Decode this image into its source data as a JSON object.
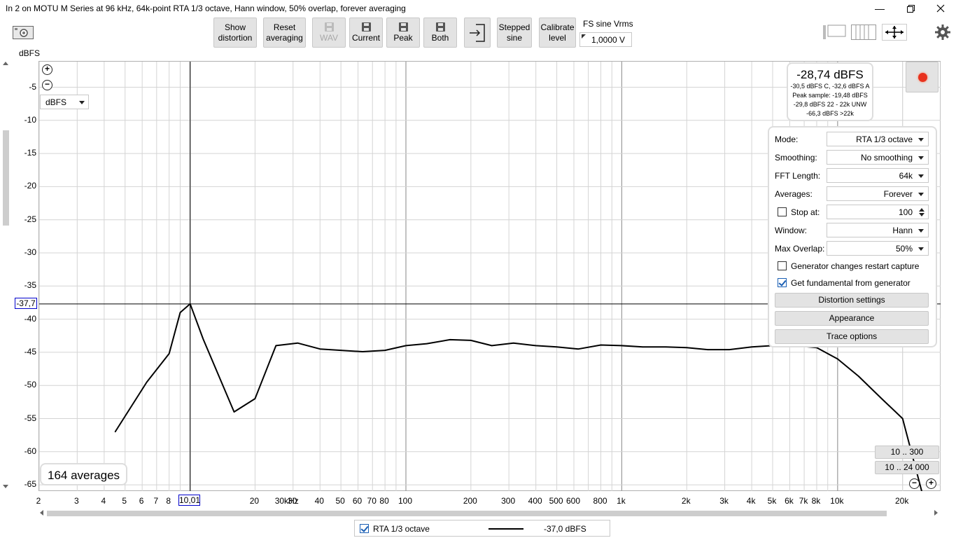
{
  "window": {
    "title": "In 2 on MOTU M Series at 96 kHz, 64k-point RTA 1/3 octave, Hann window, 50% overlap, forever averaging"
  },
  "toolbar": {
    "show_distortion": [
      "Show",
      "distortion"
    ],
    "reset_averaging": [
      "Reset",
      "averaging"
    ],
    "wav": "WAV",
    "current": "Current",
    "peak": "Peak",
    "both": "Both",
    "stepped_sine": [
      "Stepped",
      "sine"
    ],
    "calibrate_level": [
      "Calibrate",
      "level"
    ],
    "fs_label": "FS sine Vrms",
    "fs_value": "1,0000 V"
  },
  "plot": {
    "y_unit_label": "dBFS",
    "unit_select": "dBFS",
    "cursor_y": "-37,7",
    "cursor_x": "10,01",
    "y_ticks": [
      "-5",
      "-10",
      "-15",
      "-20",
      "-25",
      "-30",
      "-35",
      "-40",
      "-45",
      "-50",
      "-55",
      "-60",
      "-65"
    ],
    "x_ticks": [
      "2",
      "3",
      "4",
      "5",
      "6",
      "7",
      "8",
      "20",
      "30",
      "40",
      "50",
      "60",
      "70",
      "80",
      "100",
      "200",
      "300",
      "400",
      "500",
      "600",
      "800",
      "1k",
      "2k",
      "3k",
      "4k",
      "5k",
      "6k",
      "7k",
      "8k",
      "10k",
      "20k",
      "30kHz"
    ],
    "averages": "164 averages",
    "range_1": "10 .. 300",
    "range_2": "10 .. 24 000"
  },
  "level": {
    "main": "-28,74 dBFS",
    "lines": [
      "-30,5 dBFS C, -32,6 dBFS A",
      "Peak sample: -19,48 dBFS",
      "-29,8 dBFS 22 - 22k UNW",
      "-66,3 dBFS >22k"
    ]
  },
  "panel": {
    "mode_label": "Mode:",
    "mode_value": "RTA 1/3 octave",
    "smoothing_label": "Smoothing:",
    "smoothing_value": "No smoothing",
    "fft_label": "FFT Length:",
    "fft_value": "64k",
    "averages_label": "Averages:",
    "averages_value": "Forever",
    "stopat_label": "Stop at:",
    "stopat_value": "100",
    "window_label": "Window:",
    "window_value": "Hann",
    "overlap_label": "Max Overlap:",
    "overlap_value": "50%",
    "gen_restart": "Generator changes restart capture",
    "gen_fundamental": "Get fundamental from generator",
    "distortion_settings": "Distortion settings",
    "appearance": "Appearance",
    "trace_options": "Trace options"
  },
  "legend": {
    "name": "RTA 1/3 octave",
    "value": "-37,0 dBFS"
  },
  "chart_data": {
    "type": "line",
    "x_scale": "log",
    "xlim": [
      2,
      30000
    ],
    "ylim": [
      -66,
      0
    ],
    "grid": true,
    "series": [
      {
        "name": "RTA 1/3 octave",
        "x": [
          4.5,
          6.3,
          8,
          9,
          10.01,
          11.5,
          16,
          20,
          25,
          31.5,
          40,
          50,
          63,
          80,
          100,
          125,
          160,
          200,
          250,
          315,
          400,
          500,
          630,
          800,
          1000,
          1250,
          1600,
          2000,
          2500,
          3150,
          4000,
          5000,
          6300,
          8000,
          10000,
          12500,
          16000,
          20000,
          25000
        ],
        "values": [
          -57,
          -49.5,
          -45.2,
          -39,
          -37.7,
          -43,
          -54,
          -52,
          -44,
          -43.6,
          -44.5,
          -44.7,
          -44.9,
          -44.7,
          -44,
          -43.7,
          -43.1,
          -43.2,
          -44,
          -43.6,
          -44,
          -44.2,
          -44.5,
          -43.9,
          -44,
          -44.2,
          -44.2,
          -44.3,
          -44.6,
          -44.6,
          -44.2,
          -44,
          -44,
          -44.3,
          -46,
          -48.6,
          -52,
          -55,
          -67
        ]
      }
    ]
  }
}
